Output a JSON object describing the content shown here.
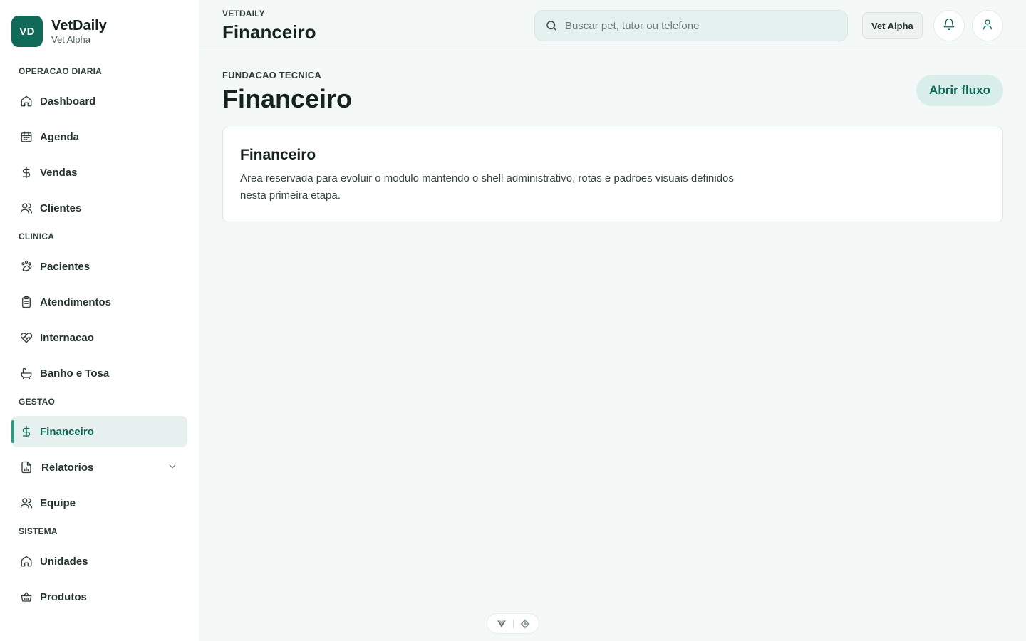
{
  "brand": {
    "initials": "VD",
    "name": "VetDaily",
    "subtitle": "Vet Alpha"
  },
  "sidebar": {
    "sections": [
      {
        "title": "OPERACAO DIARIA",
        "items": [
          {
            "label": "Dashboard",
            "icon": "home-icon"
          },
          {
            "label": "Agenda",
            "icon": "calendar-icon"
          },
          {
            "label": "Vendas",
            "icon": "dollar-icon"
          },
          {
            "label": "Clientes",
            "icon": "users-icon"
          }
        ]
      },
      {
        "title": "CLINICA",
        "items": [
          {
            "label": "Pacientes",
            "icon": "paw-icon"
          },
          {
            "label": "Atendimentos",
            "icon": "clipboard-icon"
          },
          {
            "label": "Internacao",
            "icon": "heart-pulse-icon"
          },
          {
            "label": "Banho e Tosa",
            "icon": "bath-icon"
          }
        ]
      },
      {
        "title": "GESTAO",
        "items": [
          {
            "label": "Financeiro",
            "icon": "dollar-icon",
            "active": true
          },
          {
            "label": "Relatorios",
            "icon": "report-icon",
            "expandable": true
          },
          {
            "label": "Equipe",
            "icon": "users-icon"
          }
        ]
      },
      {
        "title": "SISTEMA",
        "items": [
          {
            "label": "Unidades",
            "icon": "home-icon"
          },
          {
            "label": "Produtos",
            "icon": "basket-icon"
          }
        ]
      }
    ]
  },
  "topbar": {
    "breadcrumb": "VETDAILY",
    "title": "Financeiro",
    "search_placeholder": "Buscar pet, tutor ou telefone",
    "unit_label": "Vet Alpha"
  },
  "main": {
    "section_label": "FUNDACAO TECNICA",
    "title": "Financeiro",
    "action_label": "Abrir fluxo",
    "card": {
      "title": "Financeiro",
      "text": "Area reservada para evoluir o modulo mantendo o shell administrativo, rotas e padroes visuais definidos nesta primeira etapa."
    }
  },
  "colors": {
    "accent": "#0f6a58",
    "accent_soft": "#e6f1ef",
    "indicator": "#2f9a84"
  }
}
